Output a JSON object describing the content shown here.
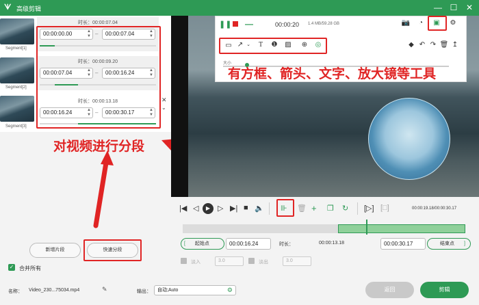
{
  "window": {
    "title": "高级剪辑",
    "controls": [
      "minimize",
      "maximize",
      "close"
    ]
  },
  "segments": [
    {
      "label": "Segment[1]",
      "duration": "时长：00:00:07.04",
      "start": "00:00:00.00",
      "end": "00:00:07.04",
      "progress": 0.12
    },
    {
      "label": "Segment[2]",
      "duration": "时长：00:00:09.20",
      "start": "00:00:07.04",
      "end": "00:00:16.24",
      "progress": 0.36
    },
    {
      "label": "Segment[3]",
      "duration": "时长：00:00:13.18",
      "start": "00:00:16.24",
      "end": "00:00:30.17",
      "progress": 1.0
    }
  ],
  "left_buttons": {
    "new_segment": "新增片段",
    "fast_split": "快速分段",
    "merge_all": "合并所有"
  },
  "annotations": {
    "segment_video": "对视频进行分段",
    "tools": "有方框、箭头、文字、放大镜等工具"
  },
  "recording_toolbar": {
    "time": "00:00:20",
    "size": "1.4 MB/59.28 GB",
    "slider_label": "大小"
  },
  "playback": {
    "time_display": "00:00:19.18/00:00:30.17",
    "start_label": "起始点",
    "start_time": "00:00:16.24",
    "duration_label": "时长：",
    "duration_value": "00:00:13.18",
    "end_time": "00:00:30.17",
    "end_label": "结束点",
    "fade_in_label": "淡入",
    "fade_in_value": "3.0",
    "fade_out_label": "淡出",
    "fade_out_value": "3.0"
  },
  "footer": {
    "name_label": "名称：",
    "name_value": "Video_230...75034.mp4",
    "output_label": "输出：",
    "output_value": "自动;Auto",
    "back": "返回",
    "cut": "剪辑"
  },
  "colors": {
    "accent": "#2e9a55",
    "annotation": "#e02424"
  }
}
